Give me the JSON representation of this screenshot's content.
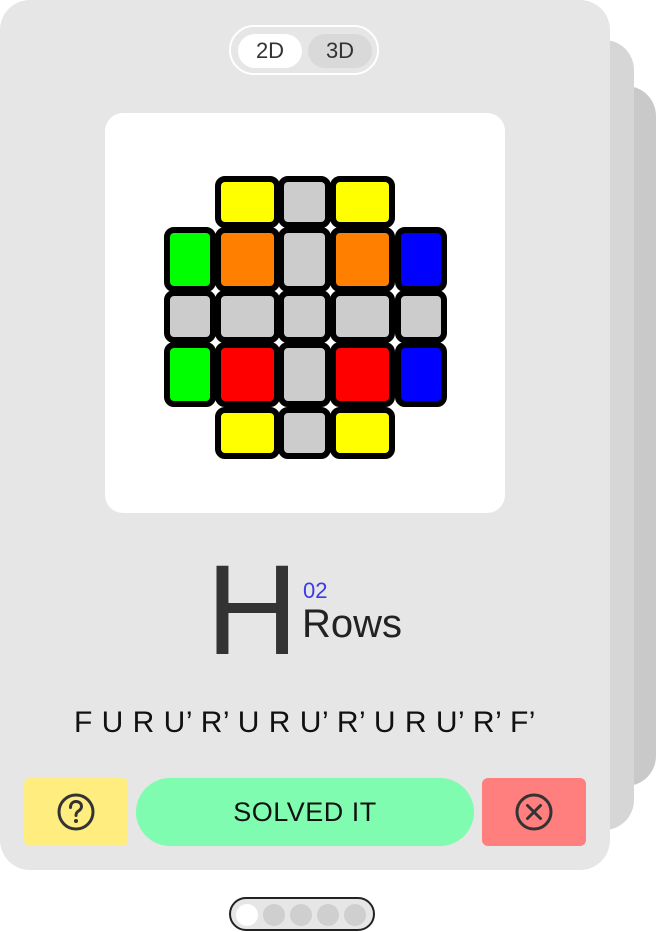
{
  "view_toggle": {
    "options": [
      "2D",
      "3D"
    ],
    "selected": "2D"
  },
  "cube": {
    "view": "2D top view",
    "top_face": [
      [
        "orange",
        "gray",
        "orange"
      ],
      [
        "gray",
        "gray",
        "gray"
      ],
      [
        "red",
        "gray",
        "red"
      ]
    ],
    "back_side": [
      "yellow",
      "gray",
      "yellow"
    ],
    "front_side": [
      "yellow",
      "gray",
      "yellow"
    ],
    "left_side": [
      "green",
      "gray",
      "green"
    ],
    "right_side": [
      "blue",
      "gray",
      "blue"
    ]
  },
  "colors": {
    "yellow": "#ffff00",
    "orange": "#ff8000",
    "red": "#ff0000",
    "green": "#00ff00",
    "blue": "#0000ff",
    "gray": "#cccccc",
    "help_button": "#ffee7f",
    "solved_button": "#7ffcb0",
    "close_button": "#ff7f7f",
    "case_number": "#3a3ae8"
  },
  "case": {
    "letter": "H",
    "number": "02",
    "name": "Rows"
  },
  "algorithm": "F U R U’ R’ U R U’ R’ U R U’ R’ F’",
  "buttons": {
    "help_icon": "question-circle-icon",
    "solved_label": "SOLVED IT",
    "close_icon": "x-circle-icon"
  },
  "pagination": {
    "total": 5,
    "current": 1
  }
}
